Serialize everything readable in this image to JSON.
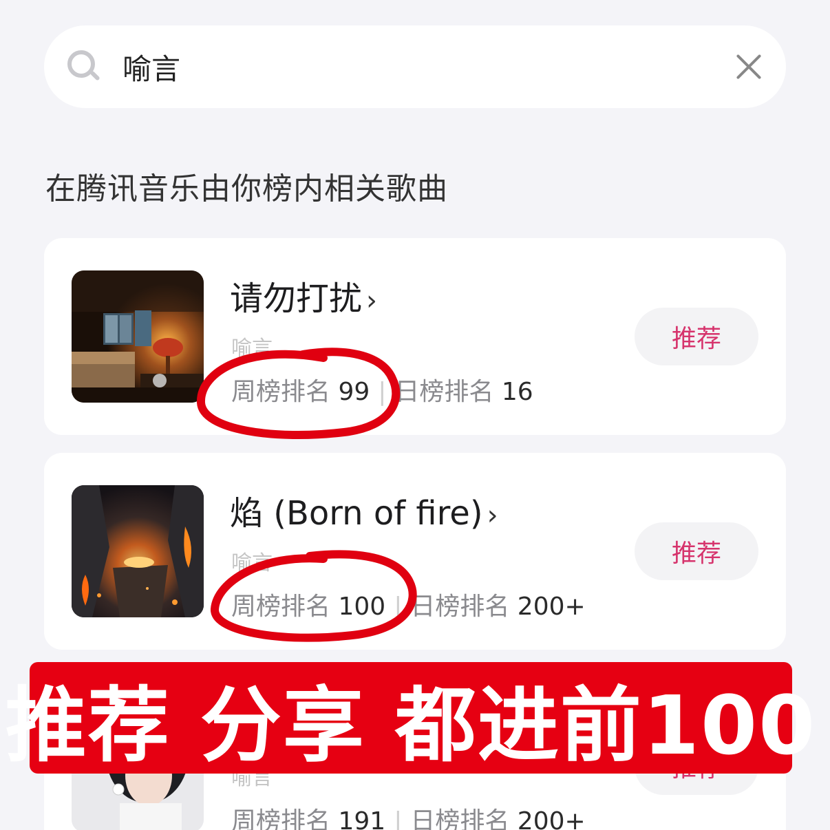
{
  "search": {
    "value": "喻言"
  },
  "section_title": "在腾讯音乐由你榜内相关歌曲",
  "songs": [
    {
      "title": "请勿打扰",
      "artist": "喻言",
      "weekly_label": "周榜排名",
      "weekly_rank": "99",
      "daily_label": "日榜排名",
      "daily_rank": "16",
      "button": "推荐"
    },
    {
      "title": "焰 (Born of fire)",
      "artist": "喻言",
      "weekly_label": "周榜排名",
      "weekly_rank": "100",
      "daily_label": "日榜排名",
      "daily_rank": "200+",
      "button": "推荐"
    },
    {
      "title": "",
      "artist": "喻言",
      "weekly_label": "周榜排名",
      "weekly_rank": "191",
      "daily_label": "日榜排名",
      "daily_rank": "200+",
      "button": "推荐"
    }
  ],
  "chevron": "›",
  "separator": "|",
  "banner": "推荐 分享 都进前100",
  "colors": {
    "accent_pink": "#d6336c",
    "banner_red": "#e60012",
    "annotation_red": "#e00010"
  }
}
